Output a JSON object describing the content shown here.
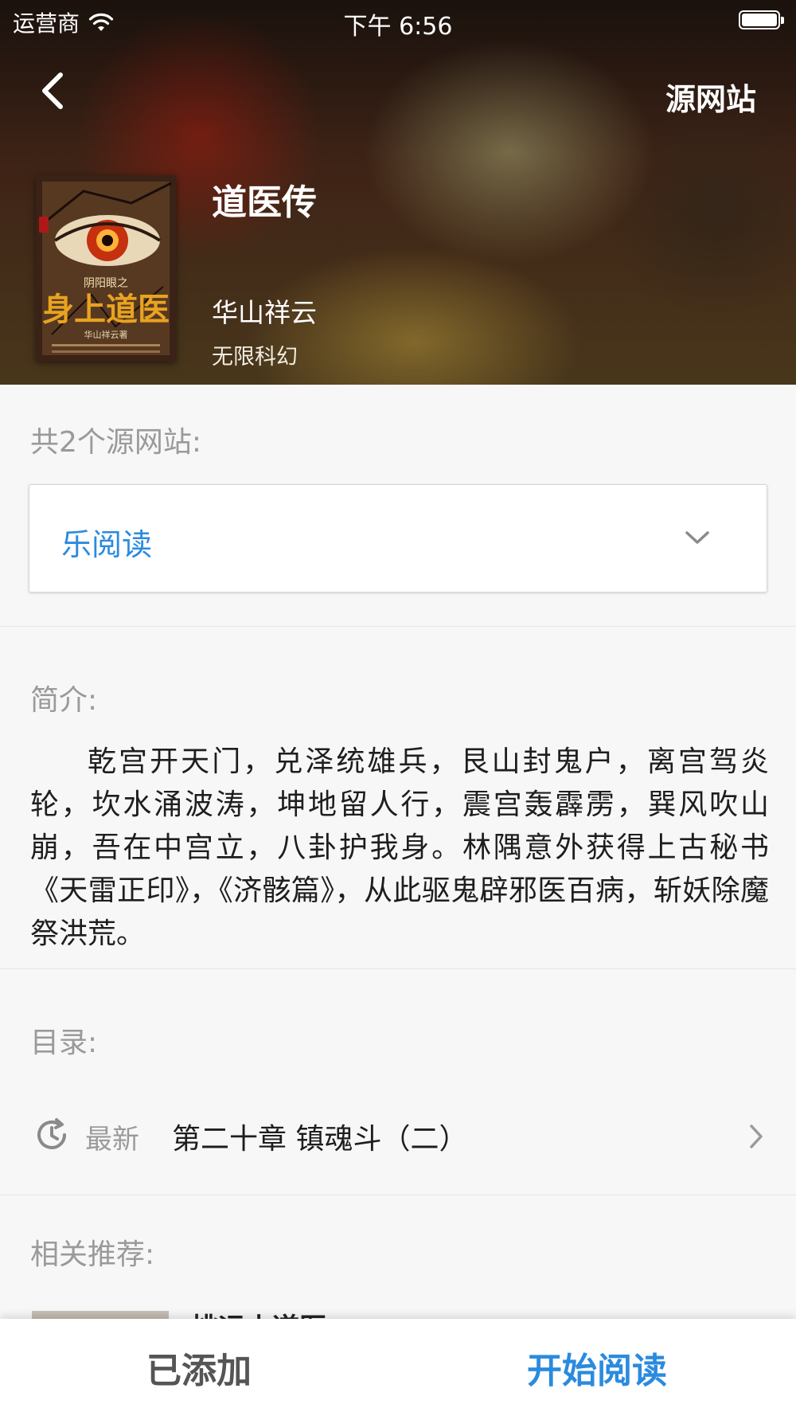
{
  "status_bar": {
    "carrier": "运营商",
    "time": "下午 6:56"
  },
  "nav": {
    "back_icon": "chevron-left-icon",
    "source_site_label": "源网站"
  },
  "book": {
    "title": "道医传",
    "author": "华山祥云",
    "genre": "无限科幻"
  },
  "sources": {
    "count_label": "共2个源网站:",
    "selected": "乐阅读",
    "options": [
      "乐阅读"
    ]
  },
  "intro": {
    "label": "简介:",
    "text": "乾宫开天门，兑泽统雄兵，艮山封鬼户，离宫驾炎轮，坎水涌波涛，坤地留人行，震宫轰霹雳，巽风吹山崩，吾在中宫立，八卦护我身。林隅意外获得上古秘书《天雷正印》，《济骸篇》，从此驱鬼辟邪医百病，斩妖除魔祭洪荒。"
  },
  "toc": {
    "label": "目录:",
    "latest_tag": "最新",
    "latest_chapter": "第二十章 镇魂斗（二）"
  },
  "recommend": {
    "label": "相关推荐:",
    "first_title": "桃运小道医"
  },
  "bottom_bar": {
    "added_label": "已添加",
    "start_reading_label": "开始阅读"
  },
  "colors": {
    "accent": "#2a8bde",
    "muted": "#9a9a9a",
    "page_bg": "#f7f7f7"
  }
}
